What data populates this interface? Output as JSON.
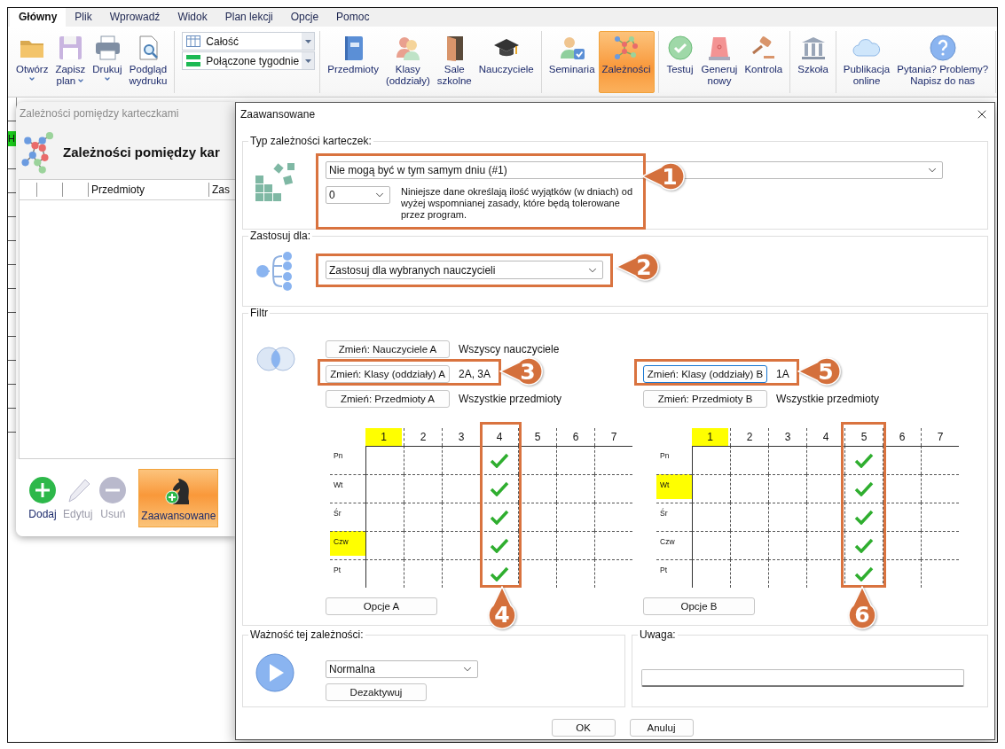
{
  "window": {
    "menu_tabs": [
      {
        "label": "Główny",
        "selected": true
      },
      {
        "label": "Plik",
        "selected": false
      },
      {
        "label": "Wprowadź",
        "selected": false
      },
      {
        "label": "Widok",
        "selected": false
      },
      {
        "label": "Plan lekcji",
        "selected": false
      },
      {
        "label": "Opcje",
        "selected": false
      },
      {
        "label": "Pomoc",
        "selected": false
      }
    ]
  },
  "ribbon": {
    "groups": [
      {
        "kind": "buttons",
        "buttons": [
          {
            "label": "Otwórz",
            "has_menu": true,
            "selected": false
          },
          {
            "label": "Zapisz\nplan",
            "has_menu": true,
            "selected": false
          },
          {
            "label": "Drukuj",
            "has_menu": true,
            "selected": false
          },
          {
            "label": "Podgląd\nwydruku",
            "has_menu": false,
            "selected": false
          }
        ]
      },
      {
        "kind": "combos",
        "combos": [
          {
            "value": "Całość"
          },
          {
            "value": "Połączone tygodnie"
          }
        ]
      },
      {
        "kind": "buttons",
        "buttons": [
          {
            "label": "Przedmioty",
            "has_menu": false,
            "selected": false
          },
          {
            "label": "Klasy\n(oddziały)",
            "has_menu": false,
            "selected": false
          },
          {
            "label": "Sale\nszkolne",
            "has_menu": false,
            "selected": false
          },
          {
            "label": "Nauczyciele",
            "has_menu": false,
            "selected": false
          }
        ]
      },
      {
        "kind": "buttons",
        "buttons": [
          {
            "label": "Seminaria",
            "has_menu": false,
            "selected": false
          },
          {
            "label": "Zależności",
            "has_menu": false,
            "selected": true
          }
        ]
      },
      {
        "kind": "buttons",
        "buttons": [
          {
            "label": "Testuj",
            "has_menu": false,
            "selected": false
          },
          {
            "label": "Generuj\nnowy",
            "has_menu": false,
            "selected": false
          },
          {
            "label": "Kontrola",
            "has_menu": false,
            "selected": false
          }
        ]
      },
      {
        "kind": "buttons",
        "buttons": [
          {
            "label": "Szkoła",
            "has_menu": false,
            "selected": false
          }
        ]
      },
      {
        "kind": "buttons",
        "buttons": [
          {
            "label": "Publikacja\nonline",
            "has_menu": false,
            "selected": false
          },
          {
            "label": "Pytania? Problemy?\nNapisz do nas",
            "has_menu": false,
            "selected": false
          }
        ]
      }
    ]
  },
  "background": {
    "cell_label": "H"
  },
  "side_window": {
    "title": "Zależności pomiędzy karteczkami",
    "heading": "Zależności pomiędzy kar",
    "columns": [
      "Przedmioty",
      "Zas"
    ],
    "actions": [
      {
        "label": "Dodaj",
        "disabled": false,
        "selected": false
      },
      {
        "label": "Edytuj",
        "disabled": true,
        "selected": false
      },
      {
        "label": "Usuń",
        "disabled": true,
        "selected": false
      },
      {
        "label": "Zaawansowane",
        "disabled": false,
        "selected": true
      }
    ]
  },
  "dialog": {
    "title": "Zaawansowane",
    "type_section": {
      "legend": "Typ zależności karteczek:",
      "type_select": "Nie mogą być w tym samym dniu (#1)",
      "exceptions_select": "0",
      "description": "Niniejsze dane określają ilość wyjątków (w dniach) od wyżej wspomnianej zasady, które będą tolerowane przez program."
    },
    "apply_section": {
      "legend": "Zastosuj dla:",
      "select": "Zastosuj dla wybranych nauczycieli"
    },
    "filter_section": {
      "legend": "Filtr",
      "sides": [
        {
          "rows": [
            {
              "button": "Zmień: Nauczyciele A",
              "value": "Wszyscy nauczyciele",
              "focused": false
            },
            {
              "button": "Zmień: Klasy (oddziały) A",
              "value": "2A, 3A",
              "focused": false
            },
            {
              "button": "Zmień: Przedmioty A",
              "value": "Wszystkie przedmioty",
              "focused": false
            }
          ],
          "grid": {
            "periods": [
              {
                "label": "1",
                "highlighted": true
              },
              {
                "label": "2",
                "highlighted": false
              },
              {
                "label": "3",
                "highlighted": false
              },
              {
                "label": "4",
                "highlighted": false
              },
              {
                "label": "5",
                "highlighted": false
              },
              {
                "label": "6",
                "highlighted": false
              },
              {
                "label": "7",
                "highlighted": false
              }
            ],
            "days": [
              {
                "label": "Pn",
                "highlighted": false,
                "checks": [
                  false,
                  false,
                  false,
                  true,
                  false,
                  false,
                  false
                ]
              },
              {
                "label": "Wt",
                "highlighted": false,
                "checks": [
                  false,
                  false,
                  false,
                  true,
                  false,
                  false,
                  false
                ]
              },
              {
                "label": "Śr",
                "highlighted": false,
                "checks": [
                  false,
                  false,
                  false,
                  true,
                  false,
                  false,
                  false
                ]
              },
              {
                "label": "Czw",
                "highlighted": true,
                "checks": [
                  false,
                  false,
                  false,
                  true,
                  false,
                  false,
                  false
                ]
              },
              {
                "label": "Pt",
                "highlighted": false,
                "checks": [
                  false,
                  false,
                  false,
                  true,
                  false,
                  false,
                  false
                ]
              }
            ]
          },
          "options_button": "Opcje A"
        },
        {
          "rows": [
            {
              "button": "Zmień: Klasy (oddziały) B",
              "value": "1A",
              "focused": true
            },
            {
              "button": "Zmień: Przedmioty B",
              "value": "Wszystkie przedmioty",
              "focused": false
            }
          ],
          "grid": {
            "periods": [
              {
                "label": "1",
                "highlighted": true
              },
              {
                "label": "2",
                "highlighted": false
              },
              {
                "label": "3",
                "highlighted": false
              },
              {
                "label": "4",
                "highlighted": false
              },
              {
                "label": "5",
                "highlighted": false
              },
              {
                "label": "6",
                "highlighted": false
              },
              {
                "label": "7",
                "highlighted": false
              }
            ],
            "days": [
              {
                "label": "Pn",
                "highlighted": false,
                "checks": [
                  false,
                  false,
                  false,
                  false,
                  true,
                  false,
                  false
                ]
              },
              {
                "label": "Wt",
                "highlighted": true,
                "checks": [
                  false,
                  false,
                  false,
                  false,
                  true,
                  false,
                  false
                ]
              },
              {
                "label": "Śr",
                "highlighted": false,
                "checks": [
                  false,
                  false,
                  false,
                  false,
                  true,
                  false,
                  false
                ]
              },
              {
                "label": "Czw",
                "highlighted": false,
                "checks": [
                  false,
                  false,
                  false,
                  false,
                  true,
                  false,
                  false
                ]
              },
              {
                "label": "Pt",
                "highlighted": false,
                "checks": [
                  false,
                  false,
                  false,
                  false,
                  true,
                  false,
                  false
                ]
              }
            ]
          },
          "options_button": "Opcje B"
        }
      ]
    },
    "importance_section": {
      "legend": "Ważność tej zależności:",
      "select": "Normalna",
      "deactivate_button": "Dezaktywuj"
    },
    "note_section": {
      "legend": "Uwaga:"
    },
    "buttons": [
      {
        "label": "OK"
      },
      {
        "label": "Anuluj"
      }
    ]
  },
  "callouts": [
    {
      "label": "1"
    },
    {
      "label": "2"
    },
    {
      "label": "3"
    },
    {
      "label": "4"
    },
    {
      "label": "5"
    },
    {
      "label": "6"
    }
  ]
}
